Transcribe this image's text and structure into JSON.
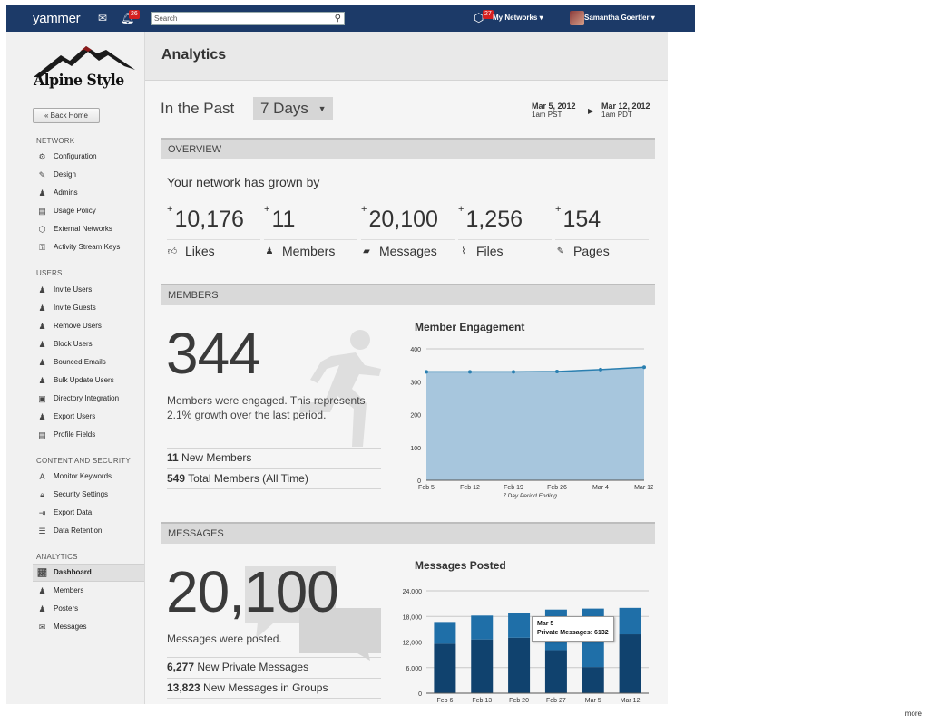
{
  "topbar": {
    "logo": "yammer",
    "mail_icon": "mail-icon",
    "notifications_count": "26",
    "search_placeholder": "Search",
    "networks_count": "27",
    "networks_label": "My Networks ▾",
    "user_label": "Samantha Goertler ▾"
  },
  "sidebar": {
    "brand": "Alpine Style",
    "back_label": "« Back Home",
    "sections": {
      "network": "NETWORK",
      "users": "USERS",
      "content": "CONTENT AND SECURITY",
      "analytics": "ANALYTICS"
    },
    "network_items": [
      "Configuration",
      "Design",
      "Admins",
      "Usage Policy",
      "External Networks",
      "Activity Stream Keys"
    ],
    "users_items": [
      "Invite Users",
      "Invite Guests",
      "Remove Users",
      "Block Users",
      "Bounced Emails",
      "Bulk Update Users",
      "Directory Integration",
      "Export Users",
      "Profile Fields"
    ],
    "content_items": [
      "Monitor Keywords",
      "Security Settings",
      "Export Data",
      "Data Retention"
    ],
    "analytics_items": [
      "Dashboard",
      "Members",
      "Posters",
      "Messages"
    ]
  },
  "main": {
    "title": "Analytics",
    "in_past": "In the Past",
    "period": "7 Days",
    "date_from": "Mar 5, 2012",
    "date_from_tz": "1am PST",
    "date_to": "Mar 12, 2012",
    "date_to_tz": "1am PDT",
    "overview": {
      "header": "OVERVIEW",
      "grown_text": "Your network has grown by",
      "stats": [
        {
          "plus": "+",
          "value": "10,176",
          "label": "Likes"
        },
        {
          "plus": "+",
          "value": "11",
          "label": "Members"
        },
        {
          "plus": "+",
          "value": "20,100",
          "label": "Messages"
        },
        {
          "plus": "+",
          "value": "1,256",
          "label": "Files"
        },
        {
          "plus": "+",
          "value": "154",
          "label": "Pages"
        }
      ]
    },
    "members": {
      "header": "MEMBERS",
      "big": "344",
      "desc": "Members were engaged. This represents 2.1% growth over the last period.",
      "rows": [
        {
          "num": "11",
          "text": "New Members"
        },
        {
          "num": "549",
          "text": "Total Members (All Time)"
        }
      ]
    },
    "messages": {
      "header": "MESSAGES",
      "big": "20,100",
      "desc": "Messages were posted.",
      "rows": [
        {
          "num": "6,277",
          "text": "New Private Messages"
        },
        {
          "num": "13,823",
          "text": "New Messages in Groups"
        }
      ]
    }
  },
  "chart_data": [
    {
      "type": "area",
      "title": "Member Engagement",
      "xlabel": "7 Day Period Ending",
      "ylabel": "",
      "categories": [
        "Feb 5",
        "Feb 12",
        "Feb 19",
        "Feb 26",
        "Mar 4",
        "Mar 12"
      ],
      "values": [
        330,
        330,
        330,
        331,
        337,
        344
      ],
      "ylim": [
        0,
        400
      ],
      "yticks": [
        0,
        100,
        200,
        300,
        400
      ],
      "colors": {
        "fill": "#a7c6dd",
        "line": "#2a7fb0"
      }
    },
    {
      "type": "bar",
      "title": "Messages Posted",
      "categories": [
        "Feb 6",
        "Feb 13",
        "Feb 20",
        "Feb 27",
        "Mar 5",
        "Mar 12"
      ],
      "series": [
        {
          "name": "Private Messages",
          "values": [
            11600,
            12600,
            13000,
            10100,
            6132,
            13800
          ],
          "color": "#10426e"
        },
        {
          "name": "Messages in Groups",
          "values": [
            5100,
            5600,
            5900,
            9500,
            13700,
            6200
          ],
          "color": "#1f6fa8"
        }
      ],
      "ylim": [
        0,
        24000
      ],
      "yticks": [
        "0",
        "6,000",
        "12,000",
        "18,000",
        "24,000"
      ],
      "tooltip": {
        "title": "Mar 5",
        "label": "Private Messages:",
        "value": "6132"
      }
    }
  ],
  "footer": {
    "more": "more"
  }
}
